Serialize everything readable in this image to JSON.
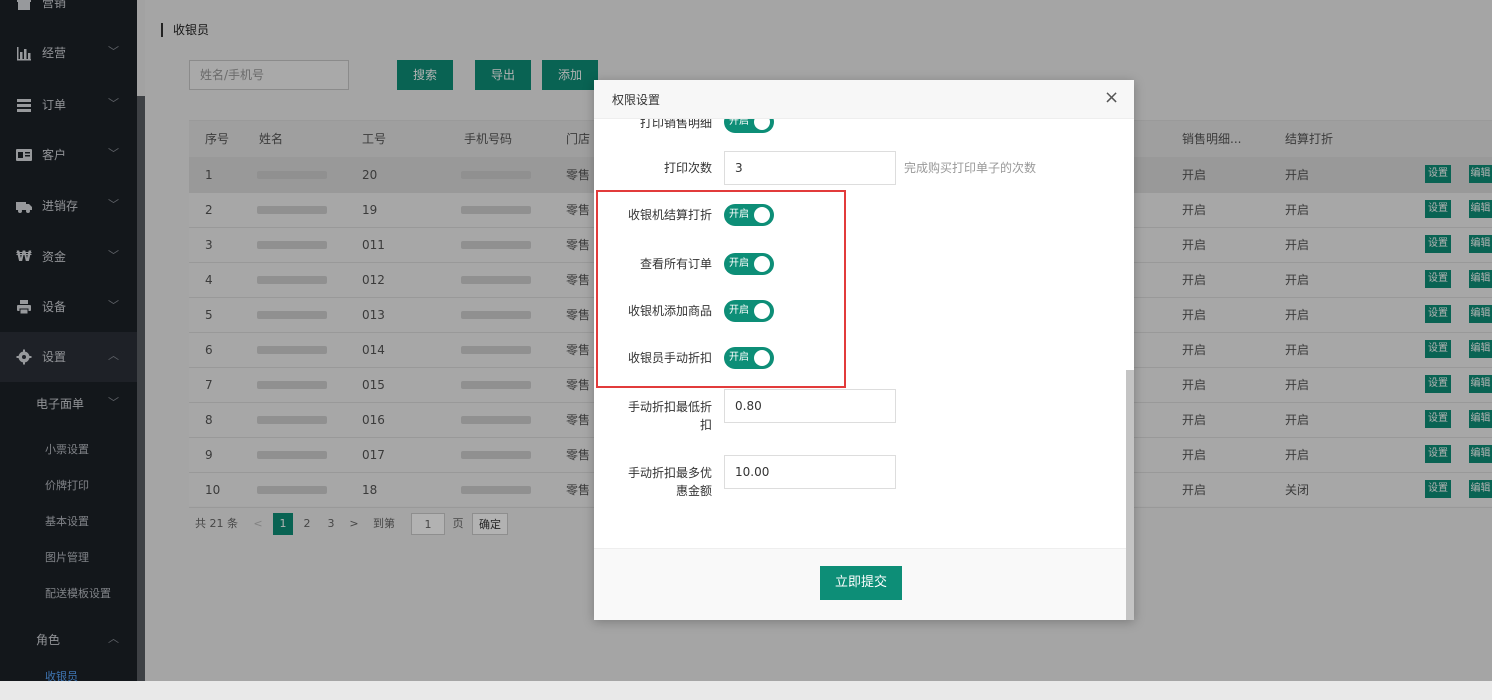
{
  "sidebar": {
    "items": [
      {
        "label": "营销",
        "icon": "gift-icon"
      },
      {
        "label": "经营",
        "icon": "bar-chart-icon"
      },
      {
        "label": "订单",
        "icon": "list-icon"
      },
      {
        "label": "客户",
        "icon": "id-card-icon"
      },
      {
        "label": "进销存",
        "icon": "truck-icon"
      },
      {
        "label": "资金",
        "icon": "won-icon"
      },
      {
        "label": "设备",
        "icon": "printer-icon"
      },
      {
        "label": "设置",
        "icon": "gear-icon"
      }
    ],
    "sub_head": "电子面单",
    "sub_items": [
      "小票设置",
      "价牌打印",
      "基本设置",
      "图片管理",
      "配送模板设置"
    ],
    "role_head": "角色",
    "active_leaf": "收银员"
  },
  "main": {
    "title": "收银员",
    "search_placeholder": "姓名/手机号",
    "buttons": {
      "search": "搜索",
      "export": "导出",
      "add": "添加"
    },
    "columns": [
      "序号",
      "姓名",
      "工号",
      "手机号码",
      "门店",
      "销售明细...",
      "结算打折"
    ],
    "rows": [
      {
        "no": "1",
        "code": "20",
        "store": "零售",
        "sales": "开启",
        "discount": "开启"
      },
      {
        "no": "2",
        "code": "19",
        "store": "零售",
        "sales": "开启",
        "discount": "开启"
      },
      {
        "no": "3",
        "code": "011",
        "store": "零售",
        "sales": "开启",
        "discount": "开启"
      },
      {
        "no": "4",
        "code": "012",
        "store": "零售",
        "sales": "开启",
        "discount": "开启"
      },
      {
        "no": "5",
        "code": "013",
        "store": "零售",
        "sales": "开启",
        "discount": "开启"
      },
      {
        "no": "6",
        "code": "014",
        "store": "零售",
        "sales": "开启",
        "discount": "开启"
      },
      {
        "no": "7",
        "code": "015",
        "store": "零售",
        "sales": "开启",
        "discount": "开启"
      },
      {
        "no": "8",
        "code": "016",
        "store": "零售",
        "sales": "开启",
        "discount": "开启"
      },
      {
        "no": "9",
        "code": "017",
        "store": "零售",
        "sales": "开启",
        "discount": "开启"
      },
      {
        "no": "10",
        "code": "18",
        "store": "零售",
        "sales": "开启",
        "discount": "关闭"
      }
    ],
    "row_actions": {
      "setting": "设置",
      "edit": "编辑"
    },
    "pager": {
      "total": "共 21 条",
      "prev": "<",
      "pages": [
        "1",
        "2",
        "3"
      ],
      "next": ">",
      "goto": "到第",
      "page_input": "1",
      "page_unit": "页",
      "confirm": "确定"
    }
  },
  "modal": {
    "title": "权限设置",
    "close": "×",
    "fields": {
      "print_sales_detail": {
        "label": "打印销售明细",
        "switch": "开启"
      },
      "print_times": {
        "label": "打印次数",
        "value": "3",
        "hint": "完成购买打印单子的次数"
      },
      "cashier_discount": {
        "label": "收银机结算打折",
        "switch": "开启"
      },
      "view_all_orders": {
        "label": "查看所有订单",
        "switch": "开启"
      },
      "cashier_add_goods": {
        "label": "收银机添加商品",
        "switch": "开启"
      },
      "cashier_manual_discount": {
        "label": "收银员手动折扣",
        "switch": "开启"
      },
      "min_manual_discount": {
        "label_1": "手动折扣最低折",
        "label_2": "扣",
        "value": "0.80"
      },
      "max_discount_amount": {
        "label_1": "手动折扣最多优",
        "label_2": "惠金额",
        "value": "10.00"
      }
    },
    "submit": "立即提交"
  },
  "colors": {
    "accent": "#0d8e77",
    "highlight": "#e23b3b",
    "sidebar_bg": "#1c2127"
  }
}
